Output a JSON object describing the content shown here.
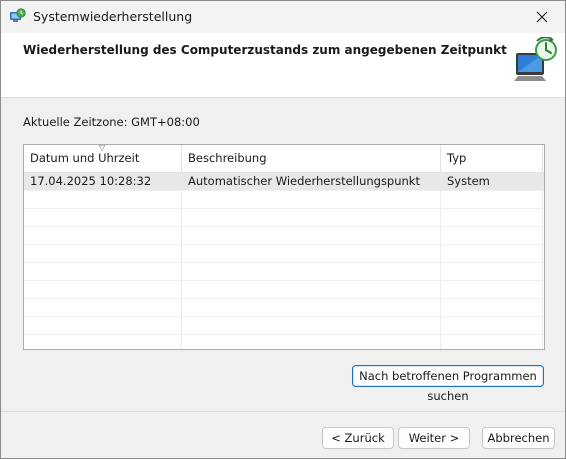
{
  "window": {
    "title": "Systemwiederherstellung"
  },
  "header": {
    "title": "Wiederherstellung des Computerzustands zum angegebenen Zeitpunkt"
  },
  "timezone_label": "Aktuelle Zeitzone: GMT+08:00",
  "table": {
    "columns": [
      "Datum und Uhrzeit",
      "Beschreibung",
      "Typ"
    ],
    "rows": [
      [
        "17.04.2025 10:28:32",
        "Automatischer Wiederherstellungspunkt",
        "System"
      ]
    ]
  },
  "buttons": {
    "scan": "Nach betroffenen Programmen suchen",
    "back": "< Zurück",
    "next": "Weiter >",
    "cancel": "Abbrechen"
  },
  "icons": {
    "app": "system-restore-icon",
    "close": "close-icon",
    "header": "computer-restore-clock-icon"
  },
  "colors": {
    "accent": "#1f6fc1",
    "selected_row": "#e8e8e8"
  }
}
